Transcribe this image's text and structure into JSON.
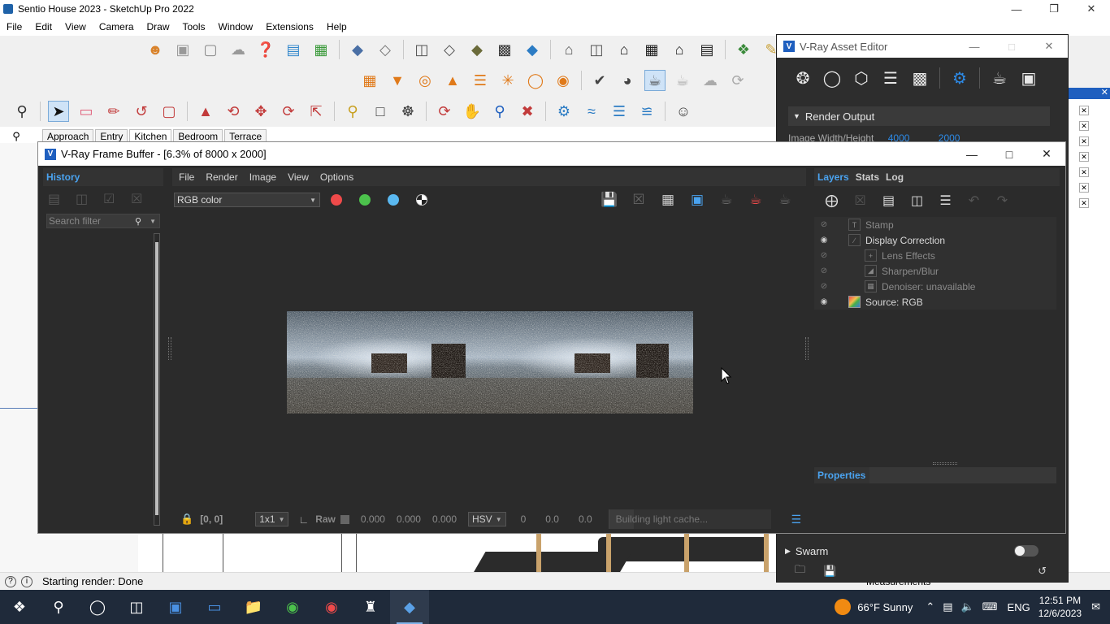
{
  "sketchup": {
    "title": "Sentio House 2023 - SketchUp Pro 2022",
    "menu": [
      "File",
      "Edit",
      "View",
      "Camera",
      "Draw",
      "Tools",
      "Window",
      "Extensions",
      "Help"
    ],
    "scene_tabs": [
      "Approach",
      "Entry",
      "Kitchen",
      "Bedroom",
      "Terrace"
    ],
    "active_scene": "Kitchen",
    "status_text": "Starting render: Done",
    "measurements_label": "Measurements"
  },
  "asset_editor": {
    "title": "V-Ray Asset Editor",
    "render_output_label": "Render Output",
    "image_wh_label": "Image Width/Height",
    "image_width": "4000",
    "image_height": "2000",
    "swarm_label": "Swarm",
    "toolbar_icons": [
      "materials-icon",
      "lights-icon",
      "geometry-icon",
      "textures-icon",
      "render-elements-icon",
      "settings-icon",
      "render-icon",
      "frame-buffer-icon"
    ]
  },
  "vfb": {
    "title": "V-Ray Frame Buffer - [6.3% of 8000 x 2000]",
    "history_label": "History",
    "search_placeholder": "Search filter",
    "menu": [
      "File",
      "Render",
      "Image",
      "View",
      "Options"
    ],
    "channel": "RGB color",
    "channel_colors": {
      "red": "#ef4a4a",
      "green": "#4cc24c",
      "blue": "#5ab8f0"
    },
    "coords": "[0, 0]",
    "zoom_ratio": "1x1",
    "raw_label": "Raw",
    "raw_values": [
      "0.000",
      "0.000",
      "0.000"
    ],
    "color_space": "HSV",
    "hsv_values": [
      "0",
      "0.0",
      "0.0"
    ],
    "render_status": "Building light cache...",
    "layer_tabs": [
      "Layers",
      "Stats",
      "Log"
    ],
    "active_layer_tab": "Layers",
    "layers": [
      {
        "name": "Stamp",
        "visible": false,
        "child": false
      },
      {
        "name": "Display Correction",
        "visible": true,
        "child": false
      },
      {
        "name": "Lens Effects",
        "visible": false,
        "child": true
      },
      {
        "name": "Sharpen/Blur",
        "visible": false,
        "child": true
      },
      {
        "name": "Denoiser: unavailable",
        "visible": false,
        "child": true
      },
      {
        "name": "Source: RGB",
        "visible": true,
        "child": false
      }
    ],
    "properties_label": "Properties"
  },
  "taskbar": {
    "weather": "66°F  Sunny",
    "language": "ENG",
    "time": "12:51 PM",
    "date": "12/6/2023"
  }
}
